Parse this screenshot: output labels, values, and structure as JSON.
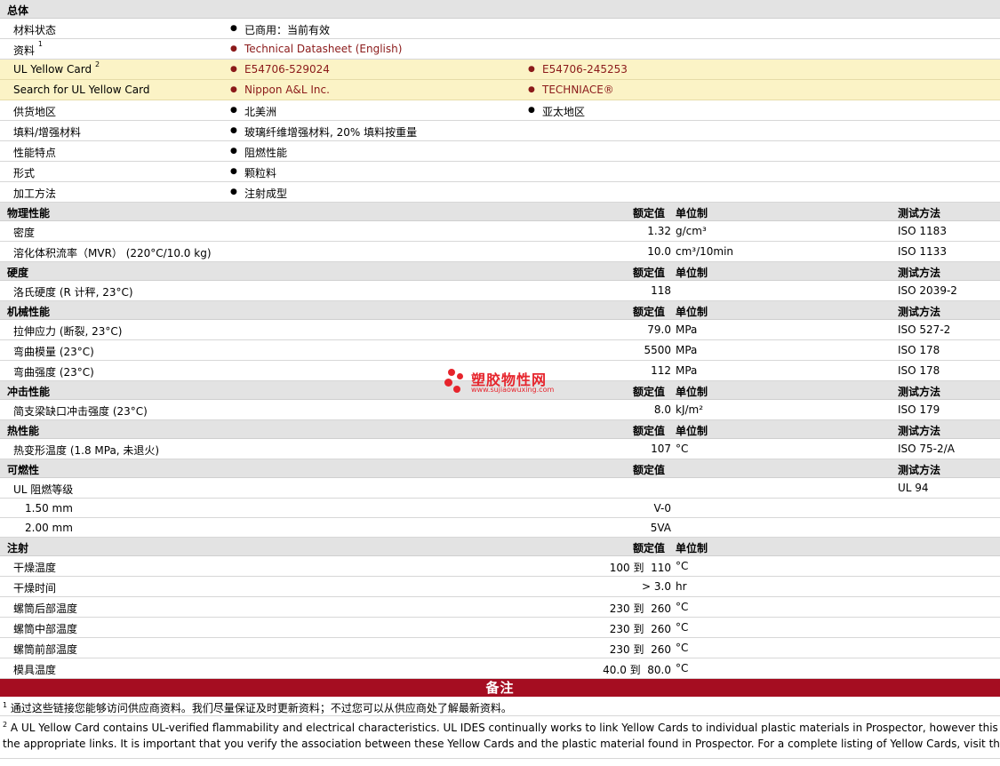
{
  "general": {
    "title": "总体",
    "rows": [
      {
        "label": "材料状态",
        "c1": "已商用：当前有效",
        "c2": ""
      },
      {
        "label": "资料",
        "sup": "1",
        "c1": "Technical Datasheet (English)",
        "c2": "",
        "link": true
      },
      {
        "label": "UL Yellow Card",
        "sup": "2",
        "c1": "E54706-529024",
        "c2": "E54706-245253",
        "link": true,
        "yellow": true
      },
      {
        "label": "Search for UL Yellow Card",
        "c1": "Nippon A&L Inc.",
        "c2": "TECHNIACE®",
        "link": true,
        "yellow": true
      },
      {
        "label": "供货地区",
        "c1": "北美洲",
        "c2": "亚太地区"
      },
      {
        "label": "填料/增强材料",
        "c1": "玻璃纤维增强材料, 20% 填料按重量",
        "c2": ""
      },
      {
        "label": "性能特点",
        "c1": "阻燃性能",
        "c2": ""
      },
      {
        "label": "形式",
        "c1": "颗粒料",
        "c2": ""
      },
      {
        "label": "加工方法",
        "c1": "注射成型",
        "c2": ""
      }
    ]
  },
  "headers": {
    "value": "额定值",
    "unit": "单位制",
    "test": "测试方法"
  },
  "sections": [
    {
      "title": "物理性能",
      "show_unit": true,
      "show_test": true,
      "rows": [
        {
          "label": "密度",
          "value": "1.32",
          "unit": "g/cm³",
          "test": "ISO 1183"
        },
        {
          "label": "溶化体积流率（MVR） (220°C/10.0 kg)",
          "value": "10.0",
          "unit": "cm³/10min",
          "test": "ISO 1133"
        }
      ]
    },
    {
      "title": "硬度",
      "show_unit": true,
      "show_test": true,
      "rows": [
        {
          "label": "洛氏硬度 (R 计秤, 23°C)",
          "value": "118",
          "unit": "",
          "test": "ISO 2039-2"
        }
      ]
    },
    {
      "title": "机械性能",
      "show_unit": true,
      "show_test": true,
      "rows": [
        {
          "label": "拉伸应力 (断裂, 23°C)",
          "value": "79.0",
          "unit": "MPa",
          "test": "ISO 527-2"
        },
        {
          "label": "弯曲模量 (23°C)",
          "value": "5500",
          "unit": "MPa",
          "test": "ISO 178"
        },
        {
          "label": "弯曲强度 (23°C)",
          "value": "112",
          "unit": "MPa",
          "test": "ISO 178"
        }
      ]
    },
    {
      "title": "冲击性能",
      "show_unit": true,
      "show_test": true,
      "rows": [
        {
          "label": "简支梁缺口冲击强度 (23°C)",
          "value": "8.0",
          "unit": "kJ/m²",
          "test": "ISO 179"
        }
      ]
    },
    {
      "title": "热性能",
      "show_unit": true,
      "show_test": true,
      "rows": [
        {
          "label": "热变形温度 (1.8 MPa, 未退火)",
          "value": "107",
          "unit": "°C",
          "test": "ISO 75-2/A"
        }
      ]
    },
    {
      "title": "可燃性",
      "show_unit": false,
      "show_test": true,
      "rows": [
        {
          "label": "UL 阻燃等级",
          "value": "",
          "unit": "",
          "test": "UL 94"
        },
        {
          "label": "1.50 mm",
          "value": "V-0",
          "unit": "",
          "test": "",
          "indent": true
        },
        {
          "label": "2.00 mm",
          "value": "5VA",
          "unit": "",
          "test": "",
          "indent": true
        }
      ]
    },
    {
      "title": "注射",
      "show_unit": true,
      "show_test": false,
      "rows": [
        {
          "label": "干燥温度",
          "value": "100 到  110",
          "unit": "°C",
          "test": ""
        },
        {
          "label": "干燥时间",
          "value": "> 3.0",
          "unit": "hr",
          "test": ""
        },
        {
          "label": "螺筒后部温度",
          "value": "230 到  260",
          "unit": "°C",
          "test": ""
        },
        {
          "label": "螺筒中部温度",
          "value": "230 到  260",
          "unit": "°C",
          "test": ""
        },
        {
          "label": "螺筒前部温度",
          "value": "230 到  260",
          "unit": "°C",
          "test": ""
        },
        {
          "label": "模具温度",
          "value": "40.0 到  80.0",
          "unit": "°C",
          "test": ""
        }
      ]
    }
  ],
  "notes": {
    "title": "备注",
    "n1_sup": "1",
    "n1": "通过这些链接您能够访问供应商资料。我们尽量保证及时更新资料；不过您可以从供应商处了解最新资料。",
    "n2_sup": "2",
    "n2_line1": "A UL Yellow Card contains UL-verified flammability and electrical characteristics. UL IDES continually works to link Yellow Cards to individual plastic materials in Prospector, however this list may not include all of",
    "n2_line2": "the appropriate links. It is important that you verify the association between these Yellow Cards and the plastic material found in Prospector. For a complete listing of Yellow Cards, visit the UL Yellow Card Search."
  },
  "watermark": {
    "cn": "塑胶物性网",
    "url": "www.sujiaowuxing.com"
  }
}
